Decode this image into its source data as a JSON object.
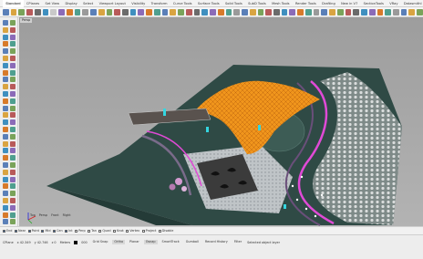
{
  "menu_tabs": [
    "Standard",
    "CPlanes",
    "Set View",
    "Display",
    "Select",
    "Viewport Layout",
    "Visibility",
    "Transform",
    "Curve Tools",
    "Surface Tools",
    "Solid Tools",
    "SubD Tools",
    "Mesh Tools",
    "Render Tools",
    "Drafting",
    "New in V7",
    "SectionTools",
    "VRay",
    "DatasmithI"
  ],
  "active_tab_index": 0,
  "viewport_label": "Persp",
  "view_tabs": [
    "Top",
    "Persp",
    "Front",
    "Right"
  ],
  "osnaps": [
    {
      "label": "End",
      "on": true
    },
    {
      "label": "Near",
      "on": true
    },
    {
      "label": "Point",
      "on": true
    },
    {
      "label": "Mid",
      "on": true
    },
    {
      "label": "Cen",
      "on": true
    },
    {
      "label": "Int",
      "on": true
    },
    {
      "label": "Perp",
      "on": false
    },
    {
      "label": "Tan",
      "on": false
    },
    {
      "label": "Quad",
      "on": false
    },
    {
      "label": "Knot",
      "on": false
    },
    {
      "label": "Vertex",
      "on": false
    },
    {
      "label": "Project",
      "on": false
    },
    {
      "label": "Disable",
      "on": false
    }
  ],
  "status": {
    "cplane": "CPlane",
    "x": "x 42.349",
    "y": "y 42.746",
    "z": "z 0",
    "units": "Meters",
    "layer": "000",
    "panes": [
      "Grid Snap",
      "Ortho",
      "Planar",
      "Osnap",
      "SmartTrack",
      "Gumball",
      "Record History",
      "Filter"
    ],
    "active_panes": [
      1,
      3
    ],
    "message": "Selected object layer"
  },
  "colors": {
    "ground": "#2f4a45",
    "canopy": "#f0951c",
    "paving": "#bfc4c7",
    "magenta": "#e04ad6",
    "viewport_bg": "#a3a3a3"
  }
}
